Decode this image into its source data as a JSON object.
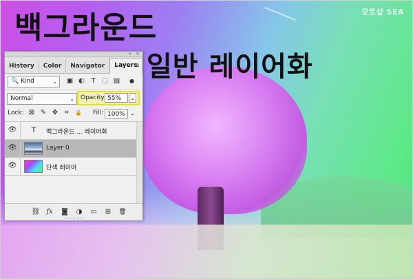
{
  "overlay": {
    "title_line1": "백그라운드",
    "title_line2": "일반 레이어화",
    "watermark": "모토샵 SEA"
  },
  "panel": {
    "collapse_glyph": "«",
    "close_glyph": "×",
    "tabs": [
      {
        "label": "History"
      },
      {
        "label": "Color"
      },
      {
        "label": "Navigator"
      },
      {
        "label": "Layers",
        "active": true
      }
    ],
    "menu_glyph": "≡",
    "filter": {
      "kind_icon": "🔍",
      "kind_label": "Kind",
      "chevron": "⌄",
      "icons": [
        {
          "name": "pixel-filter-icon",
          "glyph": "▣"
        },
        {
          "name": "adjustment-filter-icon",
          "glyph": "◐"
        },
        {
          "name": "type-filter-icon",
          "glyph": "T"
        },
        {
          "name": "shape-filter-icon",
          "glyph": "⬚"
        },
        {
          "name": "smart-object-filter-icon",
          "glyph": "▤"
        },
        {
          "name": "filter-toggle-icon",
          "glyph": "●"
        }
      ]
    },
    "blend_mode": "Normal",
    "opacity_label": "Opacity:",
    "opacity_value": "55%",
    "lock_label": "Lock:",
    "lock_icons": [
      {
        "name": "lock-transparent-icon",
        "glyph": "⊠"
      },
      {
        "name": "lock-image-icon",
        "glyph": "✎"
      },
      {
        "name": "lock-position-icon",
        "glyph": "✥"
      },
      {
        "name": "lock-artboard-icon",
        "glyph": "⌗"
      },
      {
        "name": "lock-all-icon",
        "glyph": "🔒"
      }
    ],
    "fill_label": "Fill:",
    "fill_value": "100%",
    "layers": [
      {
        "name": "백그라운드 ... 레이어화",
        "type": "text",
        "glyph": "T",
        "selected": false
      },
      {
        "name": "Layer 0",
        "type": "photo",
        "selected": true
      },
      {
        "name": "단색 레이어",
        "type": "gradient",
        "selected": false
      }
    ],
    "eye_glyph": "👁",
    "bottom_icons": [
      {
        "name": "link-layers-icon",
        "glyph": "⛓"
      },
      {
        "name": "fx-icon",
        "glyph": "fx"
      },
      {
        "name": "add-mask-icon",
        "glyph": "◙"
      },
      {
        "name": "adjustment-layer-icon",
        "glyph": "◑"
      },
      {
        "name": "new-group-icon",
        "glyph": "▭"
      },
      {
        "name": "new-layer-icon",
        "glyph": "⊞"
      },
      {
        "name": "delete-layer-icon",
        "glyph": "🗑"
      }
    ]
  }
}
